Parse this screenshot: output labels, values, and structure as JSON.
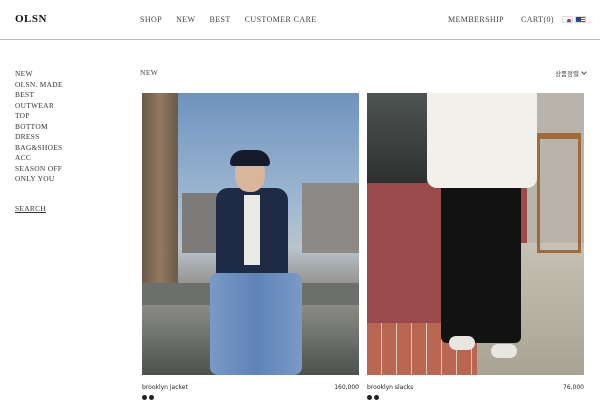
{
  "header": {
    "logo": "OLSN",
    "nav": [
      "SHOP",
      "NEW",
      "BEST",
      "CUSTOMER CARE"
    ],
    "membership": "MEMBERSHIP",
    "cart": "CART(0)",
    "flags": [
      "kr-flag-icon",
      "us-flag-icon"
    ]
  },
  "sidebar": {
    "items": [
      "NEW",
      "OLSN. MADE",
      "BEST",
      "OUTWEAR",
      "TOP",
      "BOTTOM",
      "DRESS",
      "BAG&SHOES",
      "ACC",
      "SEASON OFF",
      "ONLY YOU"
    ],
    "search": "SEARCH"
  },
  "main": {
    "title": "NEW",
    "sort_label": "상품정렬",
    "products": [
      {
        "name": "brooklyn jacket",
        "price": "160,000",
        "swatch_colors": [
          "#222222",
          "#222222"
        ]
      },
      {
        "name": "brooklyn slacks",
        "price": "76,000",
        "swatch_colors": [
          "#222222",
          "#222222"
        ]
      }
    ]
  }
}
